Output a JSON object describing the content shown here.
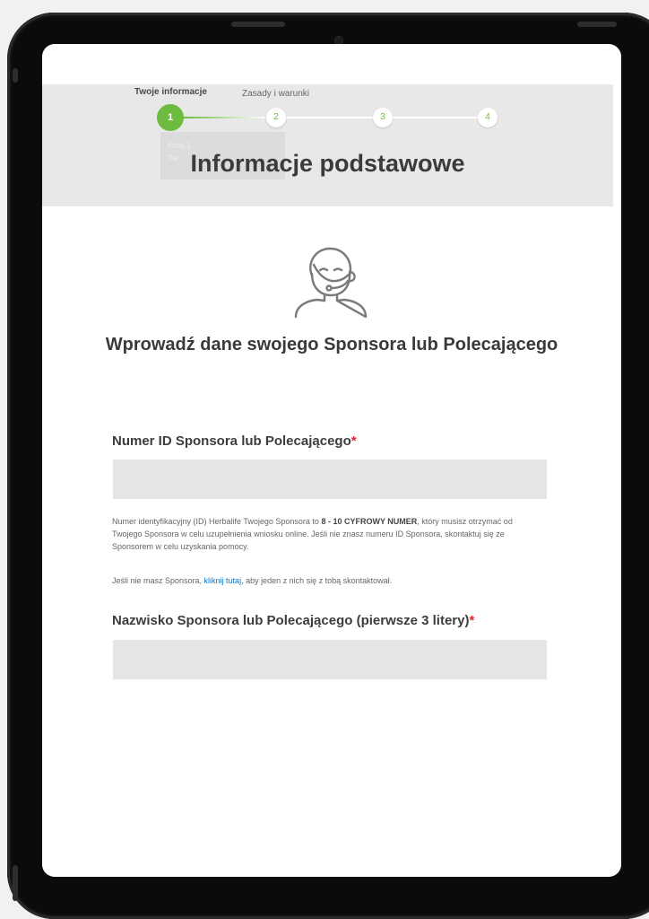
{
  "stepper": {
    "steps": [
      {
        "number": "1",
        "label": "Twoje informacje",
        "active": true
      },
      {
        "number": "2",
        "label": "Zasady i warunki",
        "active": false
      },
      {
        "number": "3",
        "label": "",
        "active": false
      },
      {
        "number": "4",
        "label": "",
        "active": false
      }
    ],
    "tooltip_line1": "Krok 1",
    "tooltip_line2": "Tw"
  },
  "section_title": "Informacje podstawowe",
  "card": {
    "icon": "support-agent-icon",
    "heading": "Wprowadź dane swojego Sponsora lub Polecającego"
  },
  "form": {
    "sponsor_id": {
      "label": "Numer ID Sponsora lub Polecającego",
      "required_mark": "*",
      "value": "",
      "placeholder": ""
    },
    "help": {
      "part1": "Numer identyfikacyjny (ID) Herbalife Twojego Sponsora to ",
      "bold": "8 - 10 CYFROWY NUMER",
      "part2": ", który musisz otrzymać od Twojego Sponsora w celu uzupełnienia wniosku online. Jeśli nie znasz numeru ID Sponsora, skontaktuj się ze Sponsorem w celu uzyskania pomocy."
    },
    "no_sponsor": {
      "before": "Jeśli nie masz Sponsora, ",
      "link": "kliknij tutaj",
      "after": ", aby jeden z nich się z tobą skontaktował."
    },
    "sponsor_surname": {
      "label": "Nazwisko Sponsora lub Polecającego (pierwsze 3 litery)",
      "required_mark": "*",
      "value": "",
      "placeholder": ""
    }
  },
  "colors": {
    "accent": "#6ebc3f",
    "link": "#0b78c9",
    "required": "#e3232b"
  }
}
